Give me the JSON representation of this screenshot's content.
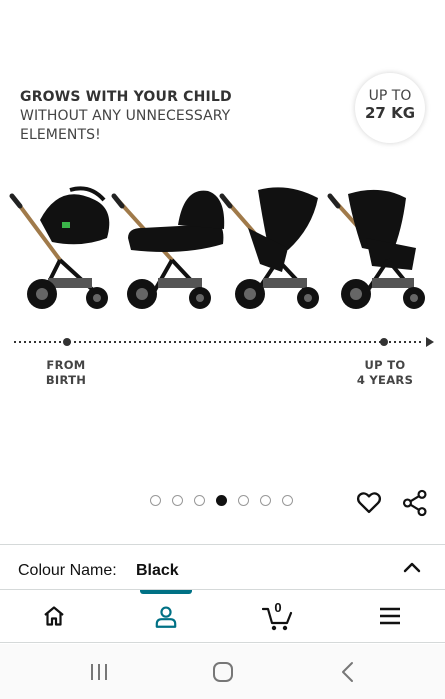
{
  "product_image": {
    "headline_bold": "GROWS WITH YOUR CHILD",
    "headline_light_1": "WITHOUT ANY UNNECESSARY",
    "headline_light_2": "ELEMENTS!",
    "badge_line1": "UP TO",
    "badge_line2": "27 KG",
    "timeline_start_line1": "FROM",
    "timeline_start_line2": "BIRTH",
    "timeline_end_line1": "UP TO",
    "timeline_end_line2": "4 YEARS",
    "stroller_variants": [
      "stroller-with-car-seat-icon",
      "stroller-with-carrycot-icon",
      "stroller-with-reclined-seat-icon",
      "stroller-with-upright-seat-icon"
    ]
  },
  "carousel": {
    "total": 7,
    "active_index": 3
  },
  "actions": {
    "favorite_icon": "heart-icon",
    "share_icon": "share-icon"
  },
  "variation": {
    "label": "Colour Name:",
    "value": "Black",
    "toggle_icon": "chevron-up-icon"
  },
  "bottom_nav": {
    "items": [
      {
        "name": "home",
        "icon": "home-icon"
      },
      {
        "name": "account",
        "icon": "user-icon",
        "active": true
      },
      {
        "name": "cart",
        "icon": "cart-icon",
        "count": "0"
      },
      {
        "name": "menu",
        "icon": "hamburger-menu-icon"
      }
    ],
    "accent": "#007185"
  },
  "system_nav": {
    "items": [
      "recent-apps-icon",
      "home-circle-icon",
      "back-icon"
    ]
  }
}
